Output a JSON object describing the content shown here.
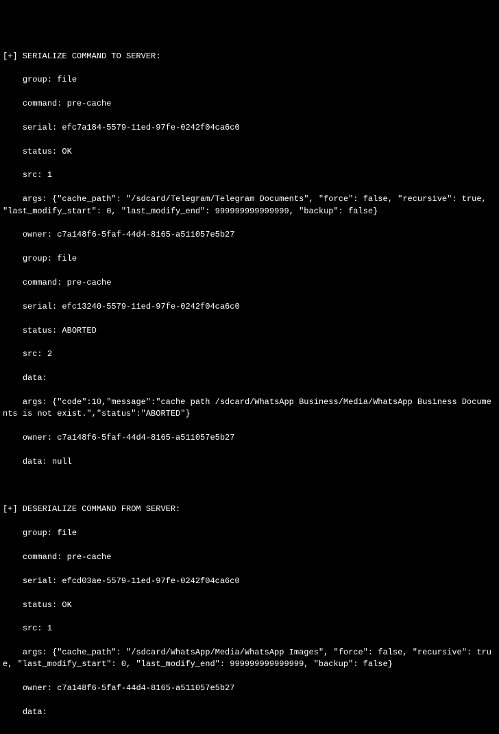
{
  "block1": {
    "header": "[+] SERIALIZE COMMAND TO SERVER:",
    "group": "    group: file",
    "command": "    command: pre-cache",
    "serial": "    serial: efc7a184-5579-11ed-97fe-0242f04ca6c0",
    "status": "    status: OK",
    "src": "    src: 1",
    "args": "    args: {\"cache_path\": \"/sdcard/Telegram/Telegram Documents\", \"force\": false, \"recursive\": true, \"last_modify_start\": 0, \"last_modify_end\": 999999999999999, \"backup\": false}",
    "owner": "    owner: c7a148f6-5faf-44d4-8165-a511057e5b27",
    "group2": "    group: file",
    "command2": "    command: pre-cache",
    "serial2": "    serial: efc13240-5579-11ed-97fe-0242f04ca6c0",
    "status2": "    status: ABORTED",
    "src2": "    src: 2",
    "data2": "    data:",
    "args2": "    args: {\"code\":10,\"message\":\"cache path /sdcard/WhatsApp Business/Media/WhatsApp Business Documents is not exist.\",\"status\":\"ABORTED\"}",
    "owner2": "    owner: c7a148f6-5faf-44d4-8165-a511057e5b27",
    "dataend": "    data: null"
  },
  "blank": " ",
  "block2": {
    "header": "[+] DESERIALIZE COMMAND FROM SERVER:",
    "group": "    group: file",
    "command": "    command: pre-cache",
    "serial": "    serial: efcd03ae-5579-11ed-97fe-0242f04ca6c0",
    "status": "    status: OK",
    "src": "    src: 1",
    "args": "    args: {\"cache_path\": \"/sdcard/WhatsApp/Media/WhatsApp Images\", \"force\": false, \"recursive\": true, \"last_modify_start\": 0, \"last_modify_end\": 999999999999999, \"backup\": false}",
    "owner": "    owner: c7a148f6-5faf-44d4-8165-a511057e5b27",
    "data": "    data:"
  }
}
